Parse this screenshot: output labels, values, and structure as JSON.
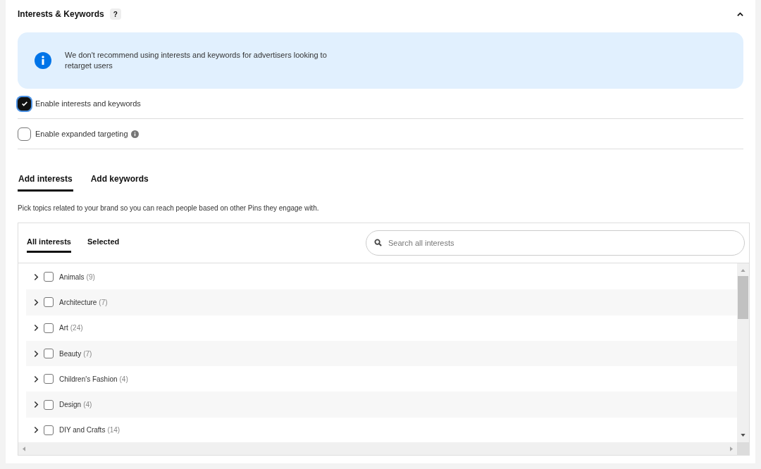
{
  "section": {
    "title": "Interests & Keywords",
    "help": "?",
    "expanded": true
  },
  "notice": {
    "text": "We don't recommend using interests and keywords for advertisers looking to retarget users"
  },
  "options": [
    {
      "label": "Enable interests and keywords",
      "checked": true,
      "info": false
    },
    {
      "label": "Enable expanded targeting",
      "checked": false,
      "info": true
    }
  ],
  "tabs": [
    {
      "label": "Add interests",
      "selected": true
    },
    {
      "label": "Add keywords",
      "selected": false
    }
  ],
  "description": "Pick topics related to your brand so you can reach people based on other Pins they engage with.",
  "browser": {
    "tabs": [
      {
        "label": "All interests",
        "selected": true
      },
      {
        "label": "Selected",
        "selected": false
      }
    ],
    "search": {
      "placeholder": "Search all interests"
    },
    "items": [
      {
        "name": "Animals",
        "count": "(9)",
        "checked": false,
        "expanded": false
      },
      {
        "name": "Architecture",
        "count": "(7)",
        "checked": false,
        "expanded": false
      },
      {
        "name": "Art",
        "count": "(24)",
        "checked": false,
        "expanded": false
      },
      {
        "name": "Beauty",
        "count": "(7)",
        "checked": false,
        "expanded": false
      },
      {
        "name": "Children's Fashion",
        "count": "(4)",
        "checked": false,
        "expanded": false
      },
      {
        "name": "Design",
        "count": "(4)",
        "checked": false,
        "expanded": false
      },
      {
        "name": "DIY and Crafts",
        "count": "(14)",
        "checked": false,
        "expanded": false
      }
    ]
  }
}
